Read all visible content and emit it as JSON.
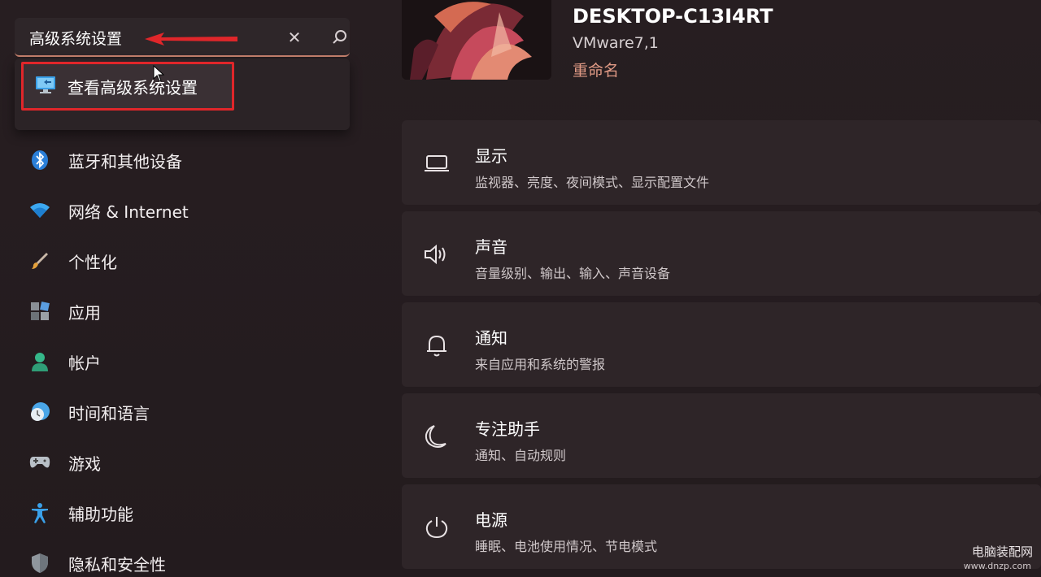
{
  "search": {
    "value": "高级系统设置",
    "suggestion": "查看高级系统设置"
  },
  "nav": {
    "items": [
      {
        "label": "蓝牙和其他设备",
        "icon": "bluetooth-icon"
      },
      {
        "label": "网络 & Internet",
        "icon": "wifi-icon"
      },
      {
        "label": "个性化",
        "icon": "brush-icon"
      },
      {
        "label": "应用",
        "icon": "apps-icon"
      },
      {
        "label": "帐户",
        "icon": "person-icon"
      },
      {
        "label": "时间和语言",
        "icon": "clock-globe-icon"
      },
      {
        "label": "游戏",
        "icon": "gamepad-icon"
      },
      {
        "label": "辅助功能",
        "icon": "accessibility-icon"
      },
      {
        "label": "隐私和安全性",
        "icon": "shield-icon"
      }
    ]
  },
  "device": {
    "name": "DESKTOP-C13I4RT",
    "model": "VMware7,1",
    "rename": "重命名"
  },
  "cards": [
    {
      "title": "显示",
      "subtitle": "监视器、亮度、夜间模式、显示配置文件",
      "icon": "laptop-icon"
    },
    {
      "title": "声音",
      "subtitle": "音量级别、输出、输入、声音设备",
      "icon": "speaker-icon"
    },
    {
      "title": "通知",
      "subtitle": "来自应用和系统的警报",
      "icon": "bell-icon"
    },
    {
      "title": "专注助手",
      "subtitle": "通知、自动规则",
      "icon": "moon-icon"
    },
    {
      "title": "电源",
      "subtitle": "睡眠、电池使用情况、节电模式",
      "icon": "power-icon"
    }
  ],
  "watermark": {
    "name": "电脑装配网",
    "url": "www.dnzp.com"
  },
  "colors": {
    "accent": "#e09a85",
    "highlight_box": "#e0262a",
    "background": "#241c1f",
    "card": "#2e2528"
  }
}
